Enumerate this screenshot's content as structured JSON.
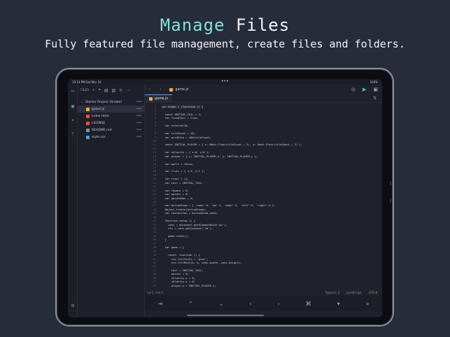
{
  "headline": {
    "accent": "Manage",
    "rest": " Files"
  },
  "subline": "Fully featured file management, create files and folders.",
  "status": {
    "time": "10:14 PM  Sat Mar 16",
    "dots": "•••",
    "battery": "100%"
  },
  "files_panel": {
    "label": "FILES",
    "project": "Starter Project (Snake)",
    "files": [
      {
        "name": "game.js",
        "color": "#e8b23a",
        "selected": true
      },
      {
        "name": "index.html",
        "color": "#e5533d",
        "selected": false
      },
      {
        "name": "LICENSE",
        "color": "#e5533d",
        "selected": false
      },
      {
        "name": "README.md",
        "color": "#8a93a3",
        "selected": false
      },
      {
        "name": "style.css",
        "color": "#4aa3f0",
        "selected": false
      }
    ],
    "more": "•••"
  },
  "editor": {
    "crumb_file": "game.js",
    "tab": "game.js",
    "lines": [
      "var Snake = (function () {",
      "",
      "  const INITIAL_TAIL = 4;",
      "  var fixedTail = true;",
      "",
      "  var intervalID;",
      "",
      "  var tileCount = 10;",
      "  var gridSize = 400/tileCount;",
      "",
      "  const INITIAL_PLAYER = { x: Math.floor(tileCount / 2), y: Math.floor(tileCount / 2) };",
      "",
      "  var velocity = { x:0, y:0 };",
      "  var player = { x: INITIAL_PLAYER.x, y: INITIAL_PLAYER.y };",
      "",
      "  var walls = false;",
      "",
      "  var fruit = { x:1, y:1 };",
      "",
      "  var trail = [];",
      "  var tail = INITIAL_TAIL;",
      "",
      "  var reward = 0;",
      "  var points = 0;",
      "  var pointsMax = 0;",
      "",
      "  var ActionEnum = { 'none':0, 'up':1, 'down':2, 'left':3, 'right':4 };",
      "  Object.freeze(ActionEnum);",
      "  var lastAction = ActionEnum.none;",
      "",
      "  function setup () {",
      "    canv = document.getElementById('gc');",
      "    ctx = canv.getContext('2d');",
      "",
      "    game.reset();",
      "  }",
      "",
      "  var game = {",
      "",
      "    reset: function () {",
      "      ctx.fillStyle = 'grey';",
      "      ctx.fillRect(0, 0, canv.width, canv.height);",
      "",
      "      tail = INITIAL_TAIL;",
      "      points = 0;",
      "      velocity.x = 0;",
      "      velocity.y = 0;",
      "      player.x = INITIAL_PLAYER.x;",
      "      player.y = INITIAL_PLAYER.y;"
    ],
    "status": {
      "position": "Ln 1, Col 1",
      "spaces": "Spaces: 2",
      "language": "JavaScript",
      "encoding": "UTF-8"
    }
  },
  "keybar": [
    "⇥",
    "⌃",
    "⌄",
    "‹",
    "›",
    "⌘",
    "▾",
    "»"
  ]
}
